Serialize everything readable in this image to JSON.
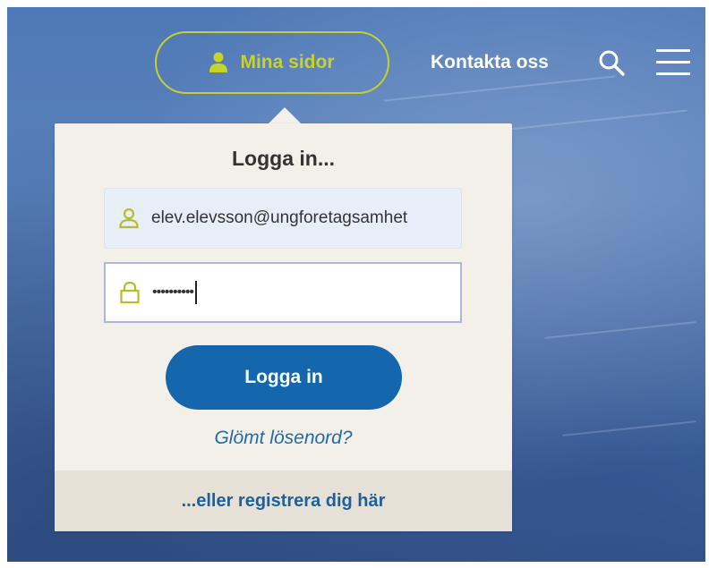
{
  "header": {
    "mina_sidor_label": "Mina sidor",
    "contact_label": "Kontakta oss",
    "icons": [
      "user-icon",
      "search-icon",
      "menu-icon"
    ],
    "accent_color": "#c9d22a"
  },
  "login": {
    "title": "Logga in...",
    "email_value": "elev.elevsson@ungforetagsamhet",
    "password_value": "••••••••••",
    "submit_label": "Logga in",
    "forgot_label": "Glömt lösenord?",
    "register_label": "...eller registrera dig här",
    "button_color": "#1467ad"
  }
}
